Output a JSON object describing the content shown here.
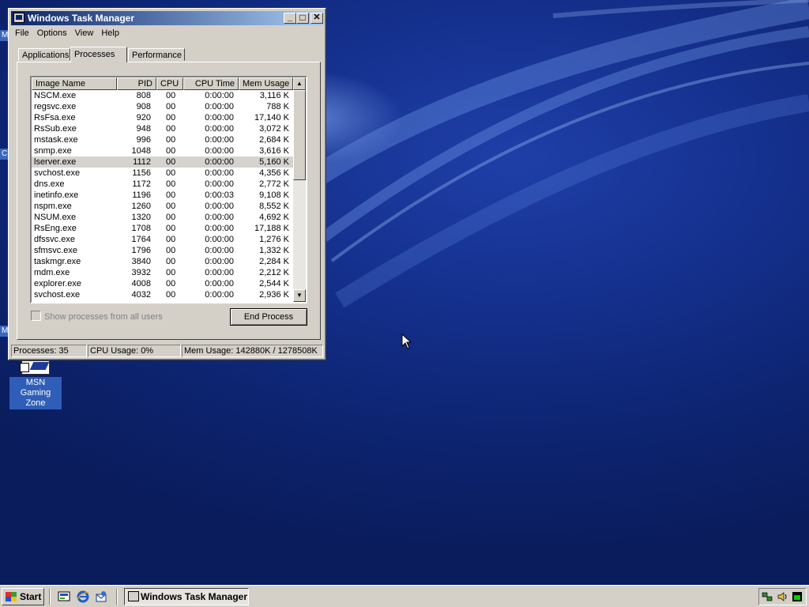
{
  "desktop": {
    "icon_label": "MSN Gaming\nZone",
    "edge_letters": [
      "M",
      "C",
      "M"
    ]
  },
  "window": {
    "title": "Windows Task Manager",
    "controls": {
      "minimize": "_",
      "maximize": "□",
      "close": "✕"
    },
    "menu": [
      "File",
      "Options",
      "View",
      "Help"
    ],
    "tabs": [
      "Applications",
      "Processes",
      "Performance"
    ],
    "active_tab": "Processes",
    "columns": [
      "Image Name",
      "PID",
      "CPU",
      "CPU Time",
      "Mem Usage"
    ],
    "processes": [
      {
        "name": "NSCM.exe",
        "pid": "808",
        "cpu": "00",
        "time": "0:00:00",
        "mem": "3,116 K"
      },
      {
        "name": "regsvc.exe",
        "pid": "908",
        "cpu": "00",
        "time": "0:00:00",
        "mem": "788 K"
      },
      {
        "name": "RsFsa.exe",
        "pid": "920",
        "cpu": "00",
        "time": "0:00:00",
        "mem": "17,140 K"
      },
      {
        "name": "RsSub.exe",
        "pid": "948",
        "cpu": "00",
        "time": "0:00:00",
        "mem": "3,072 K"
      },
      {
        "name": "mstask.exe",
        "pid": "996",
        "cpu": "00",
        "time": "0:00:00",
        "mem": "2,684 K"
      },
      {
        "name": "snmp.exe",
        "pid": "1048",
        "cpu": "00",
        "time": "0:00:00",
        "mem": "3,616 K"
      },
      {
        "name": "lserver.exe",
        "pid": "1112",
        "cpu": "00",
        "time": "0:00:00",
        "mem": "5,160 K",
        "selected": true
      },
      {
        "name": "svchost.exe",
        "pid": "1156",
        "cpu": "00",
        "time": "0:00:00",
        "mem": "4,356 K"
      },
      {
        "name": "dns.exe",
        "pid": "1172",
        "cpu": "00",
        "time": "0:00:00",
        "mem": "2,772 K"
      },
      {
        "name": "inetinfo.exe",
        "pid": "1196",
        "cpu": "00",
        "time": "0:00:03",
        "mem": "9,108 K"
      },
      {
        "name": "nspm.exe",
        "pid": "1260",
        "cpu": "00",
        "time": "0:00:00",
        "mem": "8,552 K"
      },
      {
        "name": "NSUM.exe",
        "pid": "1320",
        "cpu": "00",
        "time": "0:00:00",
        "mem": "4,692 K"
      },
      {
        "name": "RsEng.exe",
        "pid": "1708",
        "cpu": "00",
        "time": "0:00:00",
        "mem": "17,188 K"
      },
      {
        "name": "dfssvc.exe",
        "pid": "1764",
        "cpu": "00",
        "time": "0:00:00",
        "mem": "1,276 K"
      },
      {
        "name": "sfmsvc.exe",
        "pid": "1796",
        "cpu": "00",
        "time": "0:00:00",
        "mem": "1,332 K"
      },
      {
        "name": "taskmgr.exe",
        "pid": "3840",
        "cpu": "00",
        "time": "0:00:00",
        "mem": "2,284 K"
      },
      {
        "name": "mdm.exe",
        "pid": "3932",
        "cpu": "00",
        "time": "0:00:00",
        "mem": "2,212 K"
      },
      {
        "name": "explorer.exe",
        "pid": "4008",
        "cpu": "00",
        "time": "0:00:00",
        "mem": "2,544 K"
      },
      {
        "name": "svchost.exe",
        "pid": "4032",
        "cpu": "00",
        "time": "0:00:00",
        "mem": "2,936 K"
      }
    ],
    "show_all_label": "Show processes from all users",
    "end_process_label": "End Process",
    "status": {
      "processes": "Processes: 35",
      "cpu": "CPU Usage: 0%",
      "mem": "Mem Usage: 142880K / 1278508K"
    }
  },
  "taskbar": {
    "start_label": "Start",
    "task_label": "Windows Task Manager"
  }
}
